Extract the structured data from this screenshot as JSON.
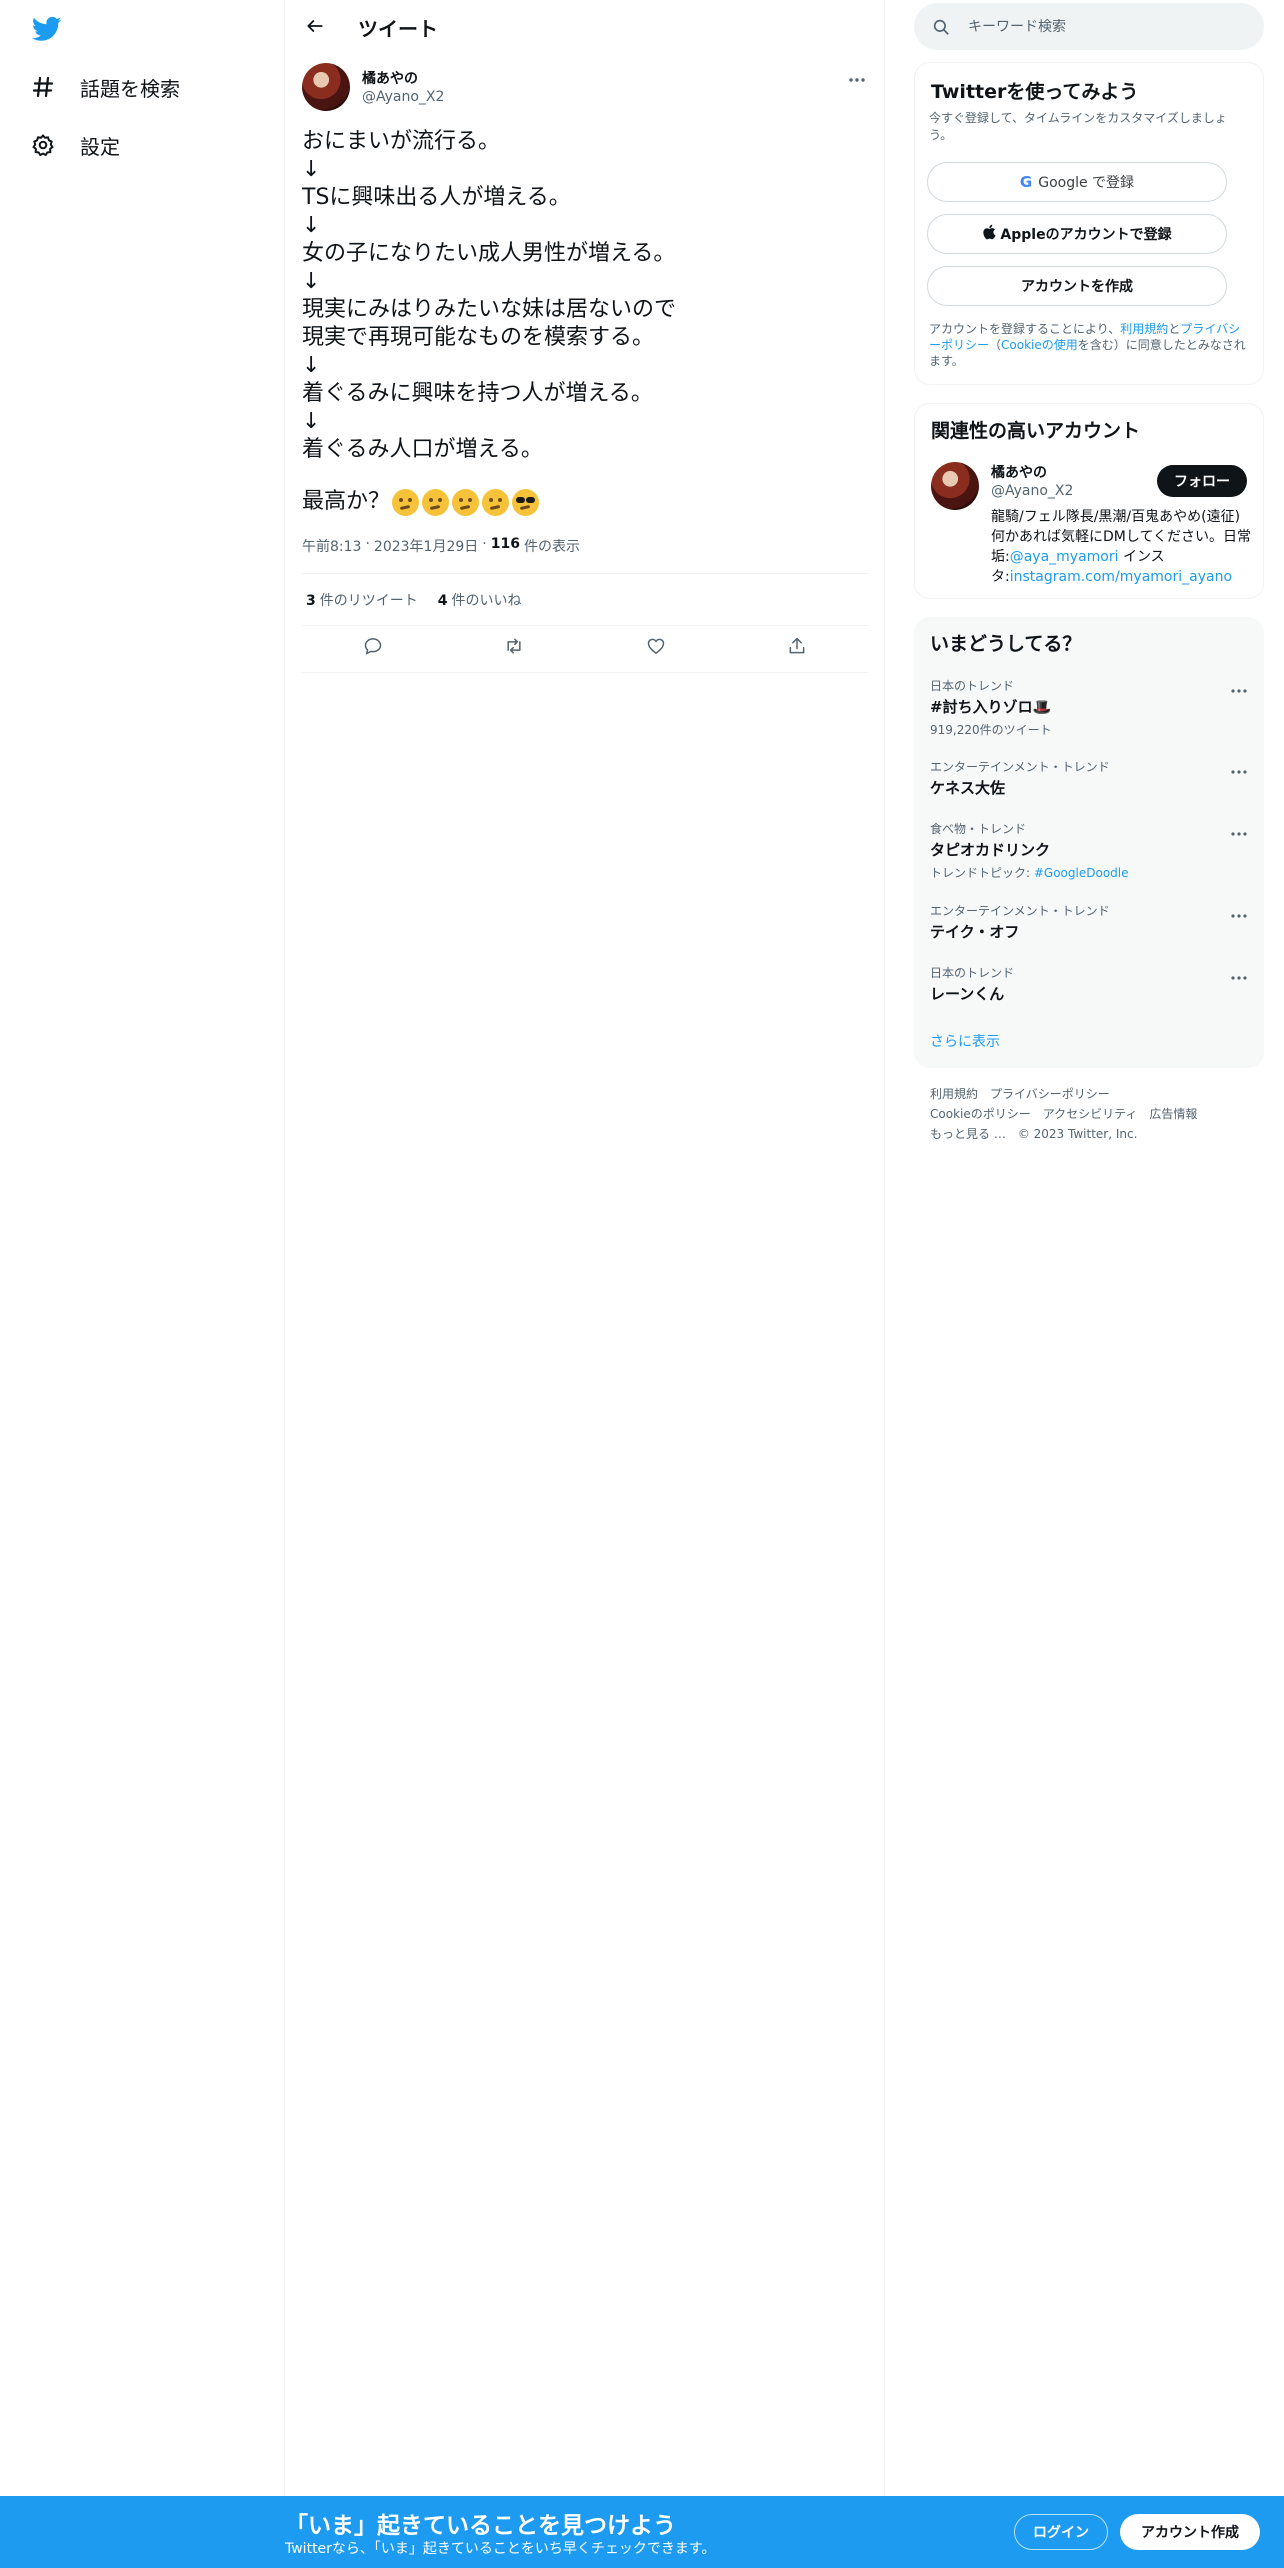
{
  "nav": {
    "logo_icon": "twitter-bird-icon",
    "items": [
      {
        "label": "話題を検索",
        "icon": "hashtag-icon"
      },
      {
        "label": "設定",
        "icon": "gear-icon"
      }
    ]
  },
  "header": {
    "title": "ツイート",
    "back_icon": "arrow-left-icon"
  },
  "tweet": {
    "author_name": "橘あやの",
    "author_handle": "@Ayano_X2",
    "lines": [
      "おにまいが流行る。",
      "↓",
      "TSに興味出る人が増える。",
      "↓",
      "女の子になりたい成人男性が増える。",
      "↓",
      "現実にみはりみたいな妹は居ないので",
      "現実で再現可能なものを模索する。",
      "↓",
      "着ぐるみに興味を持つ人が増える。",
      "↓",
      "着ぐるみ人口が増える。"
    ],
    "closing": "最高か？",
    "emojis": [
      "thinking-face-emoji",
      "thinking-face-emoji",
      "thinking-face-emoji",
      "thinking-face-emoji",
      "sunglasses-face-emoji"
    ],
    "time": "午前8:13",
    "date": "2023年1月29日",
    "views_count": "116",
    "views_label": "件の表示",
    "retweets_count": "3",
    "retweets_label": "件のリツイート",
    "likes_count": "4",
    "likes_label": "件のいいね"
  },
  "search": {
    "placeholder": "キーワード検索"
  },
  "signup": {
    "title": "Twitterを使ってみよう",
    "subtitle": "今すぐ登録して、タイムラインをカスタマイズしましょう。",
    "google_label": "Google で登録",
    "apple_label": "Appleのアカウントで登録",
    "create_label": "アカウントを作成",
    "legal_prefix": "アカウントを登録することにより、",
    "legal_terms": "利用規約",
    "legal_and": "と",
    "legal_privacy": "プライバシーポリシー",
    "legal_open": "（",
    "legal_cookie": "Cookieの使用",
    "legal_suffix": "を含む）に同意したとみなされます。"
  },
  "relevant": {
    "title": "関連性の高いアカウント",
    "name": "橘あやの",
    "handle": "@Ayano_X2",
    "follow_label": "フォロー",
    "bio_text": "龍騎/フェル隊長/黒潮/百鬼あやめ(遠征)何かあれば気軽にDMしてください。日常垢:",
    "bio_link1": "@aya_myamori",
    "bio_mid": " インスタ:",
    "bio_link2": "instagram.com/myamori_ayano"
  },
  "trends": {
    "title": "いまどうしてる？",
    "items": [
      {
        "context": "日本のトレンド",
        "name": "#討ち入りゾロ🎩",
        "sub": "919,220件のツイート"
      },
      {
        "context": "エンターテインメント・トレンド",
        "name": "ケネス大佐",
        "sub": ""
      },
      {
        "context": "食べ物・トレンド",
        "name": "タピオカドリンク",
        "sub_prefix": "トレンドトピック: ",
        "sub_link": "#GoogleDoodle"
      },
      {
        "context": "エンターテインメント・トレンド",
        "name": "テイク・オフ",
        "sub": ""
      },
      {
        "context": "日本のトレンド",
        "name": "レーンくん",
        "sub": ""
      }
    ],
    "show_more": "さらに表示"
  },
  "footer": {
    "terms": "利用規約",
    "privacy": "プライバシーポリシー",
    "cookie": "Cookieのポリシー",
    "accessibility": "アクセシビリティ",
    "ads": "広告情報",
    "more": "もっと見る …",
    "copyright": "© 2023 Twitter, Inc."
  },
  "bottom_bar": {
    "title": "「いま」起きていることを見つけよう",
    "subtitle": "Twitterなら、「いま」起きていることをいち早くチェックできます。",
    "login_label": "ログイン",
    "signup_label": "アカウント作成"
  },
  "colors": {
    "accent": "#1d9bf0",
    "text": "#0f1419",
    "secondary": "#536471",
    "border": "#eff3f4"
  }
}
